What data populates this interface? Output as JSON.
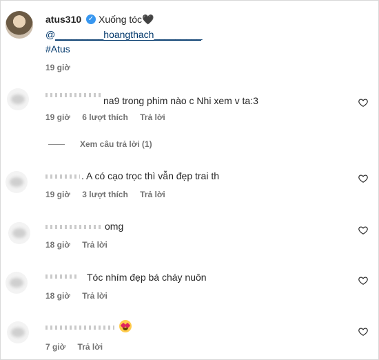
{
  "post": {
    "username": "atus310",
    "caption": "Xuống tóc🖤",
    "mention": "@_________hoangthach_________",
    "hashtag": "#Atus",
    "time": "19 giờ"
  },
  "comments": [
    {
      "text": "na9 trong phim nào c Nhi xem v ta:3",
      "time": "19 giờ",
      "likes": "6 lượt thích",
      "reply": "Trả lời"
    },
    {
      "text": ". A có cạo trọc thì vẫn đẹp trai th",
      "time": "19 giờ",
      "likes": "3 lượt thích",
      "reply": "Trả lời"
    },
    {
      "text": "omg",
      "time": "18 giờ",
      "reply": "Trả lời"
    },
    {
      "text": "Tóc nhím đẹp bá cháy nuôn",
      "time": "18 giờ",
      "reply": "Trả lời"
    },
    {
      "text": "",
      "time": "7 giờ",
      "reply": "Trả lời"
    }
  ],
  "view_replies": "Xem câu trả lời (1)",
  "icons": {
    "verified": "verified-badge-icon",
    "like": "heart-outline-icon",
    "emoji": "heart-eyes-emoji"
  },
  "colors": {
    "link": "#00376b",
    "meta": "#737373",
    "verified": "#3897f0"
  }
}
